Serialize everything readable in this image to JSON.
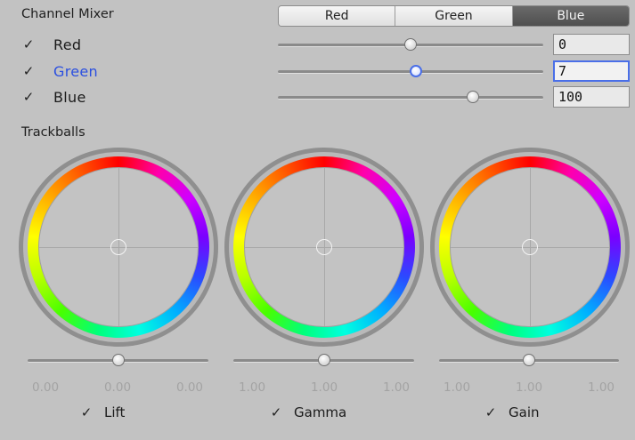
{
  "channel_mixer": {
    "title": "Channel Mixer",
    "tabs": [
      {
        "label": "Red",
        "active": false
      },
      {
        "label": "Green",
        "active": false
      },
      {
        "label": "Blue",
        "active": true
      }
    ],
    "rows": [
      {
        "label": "Red",
        "checked": true,
        "value": "0",
        "slider_fraction": 0.5
      },
      {
        "label": "Green",
        "checked": true,
        "value": "7",
        "slider_fraction": 0.52
      },
      {
        "label": "Blue",
        "checked": true,
        "value": "100",
        "slider_fraction": 0.735
      }
    ],
    "check_glyph": "✓"
  },
  "trackballs": {
    "title": "Trackballs",
    "wheels": [
      {
        "name": "Lift",
        "checked": true,
        "values": [
          "0.00",
          "0.00",
          "0.00"
        ],
        "slider_fraction": 0.5
      },
      {
        "name": "Gamma",
        "checked": true,
        "values": [
          "1.00",
          "1.00",
          "1.00"
        ],
        "slider_fraction": 0.5
      },
      {
        "name": "Gain",
        "checked": true,
        "values": [
          "1.00",
          "1.00",
          "1.00"
        ],
        "slider_fraction": 0.5
      }
    ]
  },
  "colors": {
    "background": "#c2c2c2",
    "focus_accent": "#4a6fe8",
    "active_tab": "#595959"
  }
}
